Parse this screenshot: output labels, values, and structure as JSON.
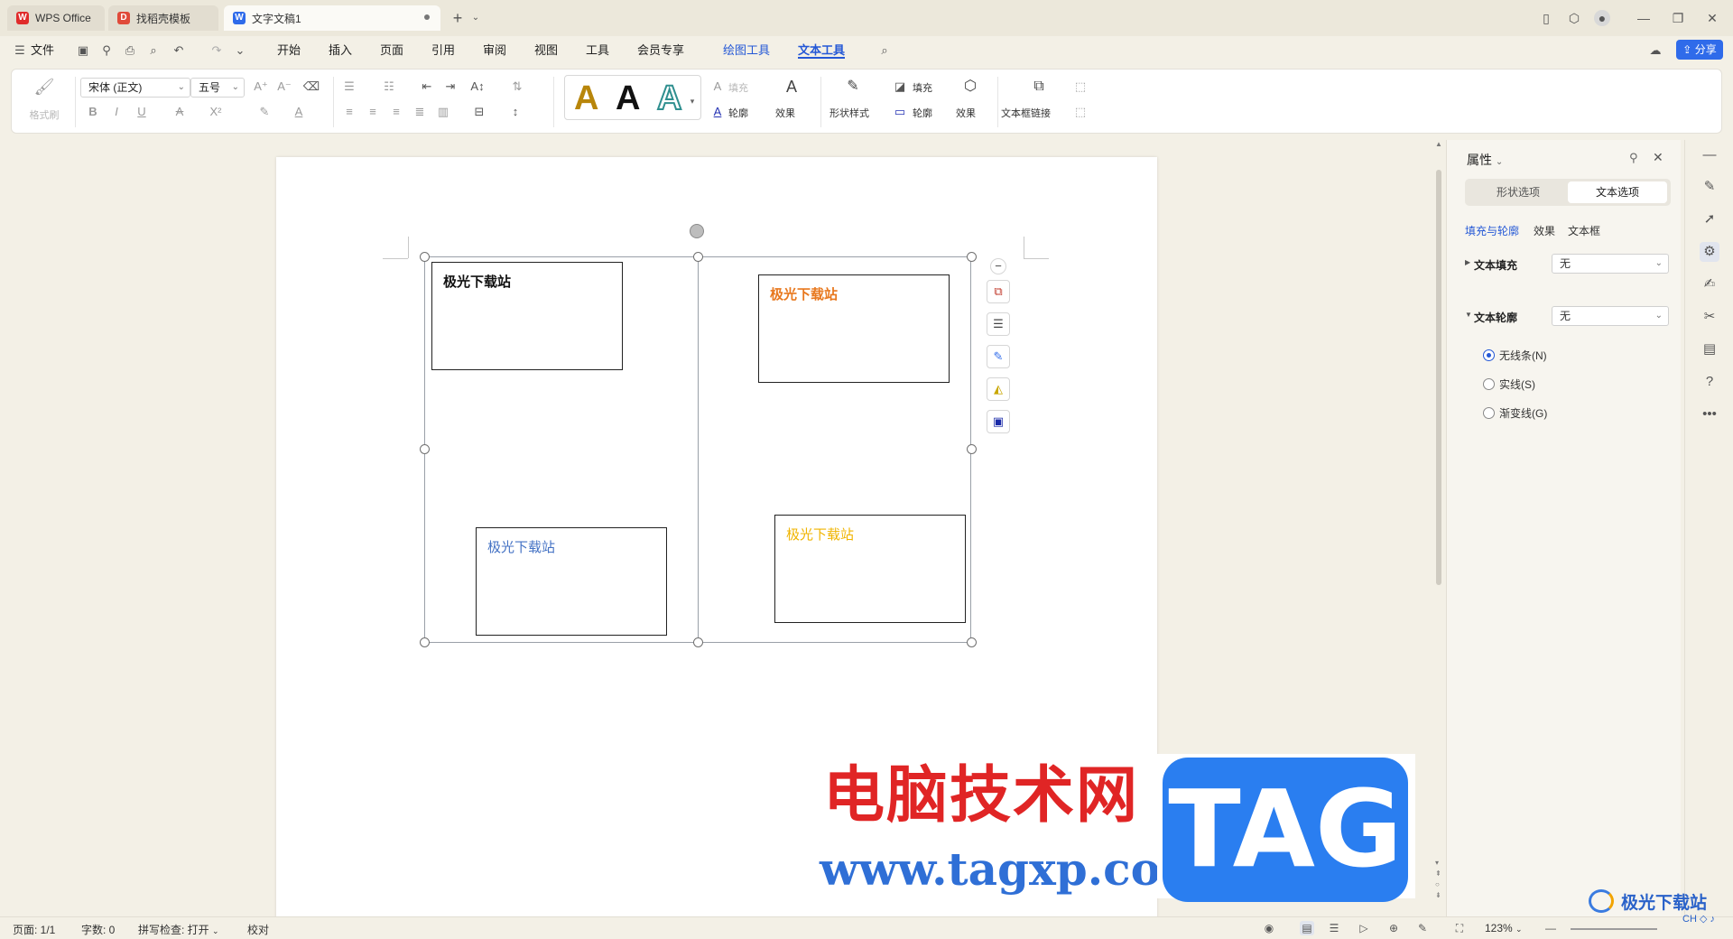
{
  "titlebar": {
    "tabs": [
      {
        "label": "WPS Office",
        "icon": "wps-logo-icon"
      },
      {
        "label": "找稻壳模板",
        "icon": "docer-icon"
      },
      {
        "label": "文字文稿1",
        "icon": "writer-doc-icon"
      }
    ],
    "new_tab_glyph": "+"
  },
  "menubar": {
    "file": "文件",
    "items": [
      "开始",
      "插入",
      "页面",
      "引用",
      "审阅",
      "视图",
      "工具",
      "会员专享"
    ],
    "context_tabs": [
      "绘图工具",
      "文本工具"
    ],
    "share": "分享"
  },
  "ribbon": {
    "format_painter": "格式刷",
    "font_name": "宋体 (正文)",
    "font_size": "五号",
    "wordart_sample": "A",
    "text_fill": "填充",
    "text_outline": "轮廓",
    "text_effect": "效果",
    "shape_style": "形状样式",
    "shape_fill": "填充",
    "shape_outline": "轮廓",
    "shape_effect": "效果",
    "textbox_link": "文本框链接",
    "colors": {
      "wordart_gold": "#b8860b",
      "wordart_black": "#111111",
      "wordart_outline": "#2f8f8f"
    }
  },
  "document": {
    "textboxes": [
      {
        "text": "极光下载站",
        "color": "#111111"
      },
      {
        "text": "极光下载站",
        "color": "#e8781e"
      },
      {
        "text": "极光下载站",
        "color": "#4472c4"
      },
      {
        "text": "极光下载站",
        "color": "#f0b400"
      }
    ]
  },
  "pane": {
    "title": "属性",
    "tabs": [
      "形状选项",
      "文本选项"
    ],
    "subtabs": [
      "填充与轮廓",
      "效果",
      "文本框"
    ],
    "text_fill_label": "文本填充",
    "text_fill_value": "无",
    "text_outline_label": "文本轮廓",
    "text_outline_value": "无",
    "line_options": [
      "无线条(N)",
      "实线(S)",
      "渐变线(G)"
    ],
    "selected_line_option": "无线条(N)"
  },
  "statusbar": {
    "page": "页面: 1/1",
    "words": "字数: 0",
    "spell": "拼写检查: 打开",
    "proof": "校对",
    "zoom": "123%"
  },
  "watermarks": {
    "cn": "电脑技术网",
    "url": "www.tagxp.com",
    "tag": "TAG",
    "site": "极光下载站",
    "site_small": "CH ◇ ♪"
  }
}
